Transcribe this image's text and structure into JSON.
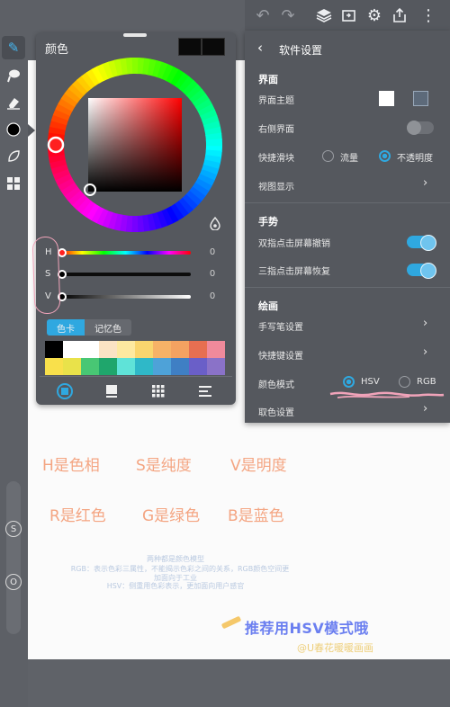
{
  "toolbar": {
    "icons": [
      "undo-icon",
      "redo-icon",
      "layers-icon",
      "import-icon",
      "gear-icon",
      "share-icon",
      "more-icon"
    ]
  },
  "left_rail": {
    "tools": [
      "brush-icon",
      "smudge-icon",
      "eraser-icon",
      "color-icon",
      "shape-icon",
      "gallery-icon"
    ],
    "size_label": "S",
    "opacity_label": "O"
  },
  "color_panel": {
    "title": "颜色",
    "hsv": {
      "letters": [
        "H",
        "S",
        "V"
      ],
      "values": [
        "0",
        "0",
        "0"
      ]
    },
    "tabs": [
      "色卡",
      "记忆色"
    ],
    "palette": [
      [
        "#000000",
        "#ffffff",
        "#ffffff",
        "#fbe3c4",
        "#fde9a0",
        "#f9d56e",
        "#f7b267",
        "#f4a261",
        "#e76f51",
        "#f08a9b"
      ],
      [
        "#f9e04b",
        "#e9e24a",
        "#48c774",
        "#1fa66c",
        "#5fe3d8",
        "#2fb8c8",
        "#4ea2d8",
        "#3f7fc4",
        "#6a5fc8",
        "#8a72c8"
      ]
    ],
    "bottom_tabs": [
      "wheel-icon",
      "book-icon",
      "grid-icon",
      "list-icon"
    ]
  },
  "settings": {
    "title": "软件设置",
    "sections": {
      "interface": "界面",
      "gesture": "手势",
      "drawing": "绘画"
    },
    "rows": {
      "theme": "界面主题",
      "right_ui": "右侧界面",
      "quick_slider": "快捷滑块",
      "quick_slider_opt1": "流量",
      "quick_slider_opt2": "不透明度",
      "view_display": "视图显示",
      "two_finger": "双指点击屏幕撤销",
      "three_finger": "三指点击屏幕恢复",
      "stylus": "手写笔设置",
      "shortcuts": "快捷键设置",
      "color_mode": "颜色模式",
      "color_mode_opt1": "HSV",
      "color_mode_opt2": "RGB",
      "pick_color": "取色设置"
    },
    "states": {
      "right_ui": false,
      "two_finger": true,
      "three_finger": true,
      "quick_slider_selected": "不透明度",
      "color_mode_selected": "HSV"
    },
    "accent": "#2fa8e0"
  },
  "annotations": {
    "h": "H是色相",
    "s": "S是纯度",
    "v": "V是明度",
    "r": "R是红色",
    "g": "G是绿色",
    "b": "B是蓝色",
    "note1": "两种都是颜色模型",
    "note2": "RGB：表示色彩三属性，不能揭示色彩之间的关系，RGB颜色空间更",
    "note3": "加面向于工业",
    "note4": "HSV：侧重用色彩表示，更加面向用户感官",
    "recommend": "推荐用HSV模式哦",
    "watermark": "@U春花暖暖画画"
  }
}
